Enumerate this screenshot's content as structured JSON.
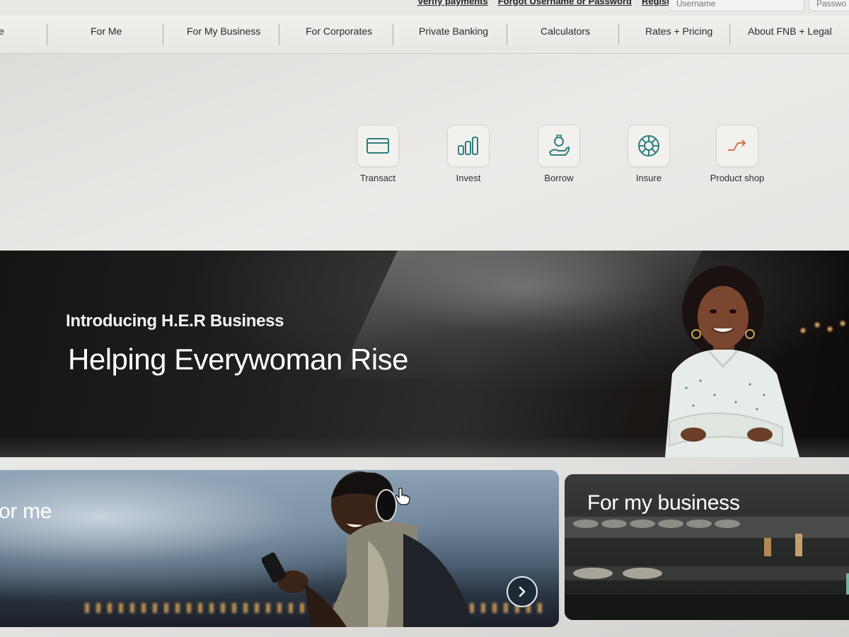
{
  "utility": {
    "links": [
      "Verify payments",
      "Forgot Username or Password",
      "Register"
    ],
    "username_placeholder": "Username",
    "password_placeholder": "Passwo"
  },
  "nav": {
    "partial_first": "e",
    "items": [
      "For Me",
      "For My Business",
      "For Corporates",
      "Private Banking",
      "Calculators",
      "Rates + Pricing",
      "About FNB + Legal"
    ]
  },
  "quick_links": [
    {
      "label": "Transact",
      "icon": "card-icon"
    },
    {
      "label": "Invest",
      "icon": "bar-chart-icon"
    },
    {
      "label": "Borrow",
      "icon": "hand-coin-icon"
    },
    {
      "label": "Insure",
      "icon": "lifebuoy-icon"
    },
    {
      "label": "Product shop",
      "icon": "swap-arrows-icon"
    }
  ],
  "hero": {
    "eyebrow": "Introducing H.E.R Business",
    "title": "Helping Everywoman Rise"
  },
  "cards": {
    "for_me": "or me",
    "for_my_business": "For my business"
  },
  "colors": {
    "icon_teal": "#2f7f7b",
    "icon_orange": "#d4734a",
    "hero_bg": "#1c1c1c"
  }
}
